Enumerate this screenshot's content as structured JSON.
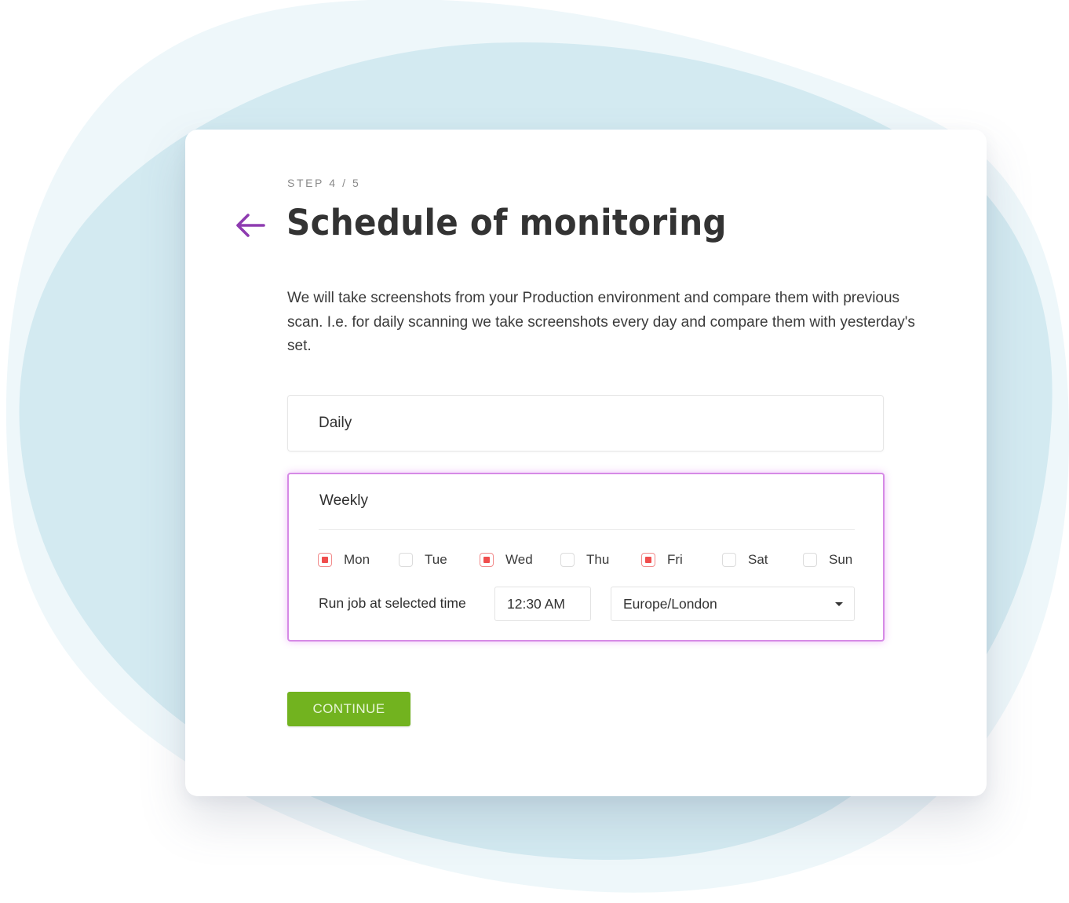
{
  "theme": {
    "accent": "#8e3bb0",
    "selected_border": "#d68ae6",
    "checkbox_checked": "#f04d4d",
    "primary_button": "#72b31f",
    "background_blob_light": "#eef7fa",
    "background_blob_dark": "#d3eaf1"
  },
  "header": {
    "step": "STEP 4 / 5",
    "back_icon": "arrow-left-icon",
    "title": "Schedule of monitoring"
  },
  "description": "We will take screenshots from your Production environment and compare them with previous scan. I.e. for daily scanning we take screenshots every day and compare them with yesterday's set.",
  "options": {
    "daily": {
      "label": "Daily",
      "selected": false
    },
    "weekly": {
      "label": "Weekly",
      "selected": true,
      "days": [
        {
          "label": "Mon",
          "checked": true
        },
        {
          "label": "Tue",
          "checked": false
        },
        {
          "label": "Wed",
          "checked": true
        },
        {
          "label": "Thu",
          "checked": false
        },
        {
          "label": "Fri",
          "checked": true
        },
        {
          "label": "Sat",
          "checked": false
        },
        {
          "label": "Sun",
          "checked": false
        }
      ],
      "time_label": "Run job at selected time",
      "time_value": "12:30 AM",
      "timezone": "Europe/London",
      "timezone_caret_icon": "caret-down-icon"
    }
  },
  "actions": {
    "continue_label": "CONTINUE"
  }
}
